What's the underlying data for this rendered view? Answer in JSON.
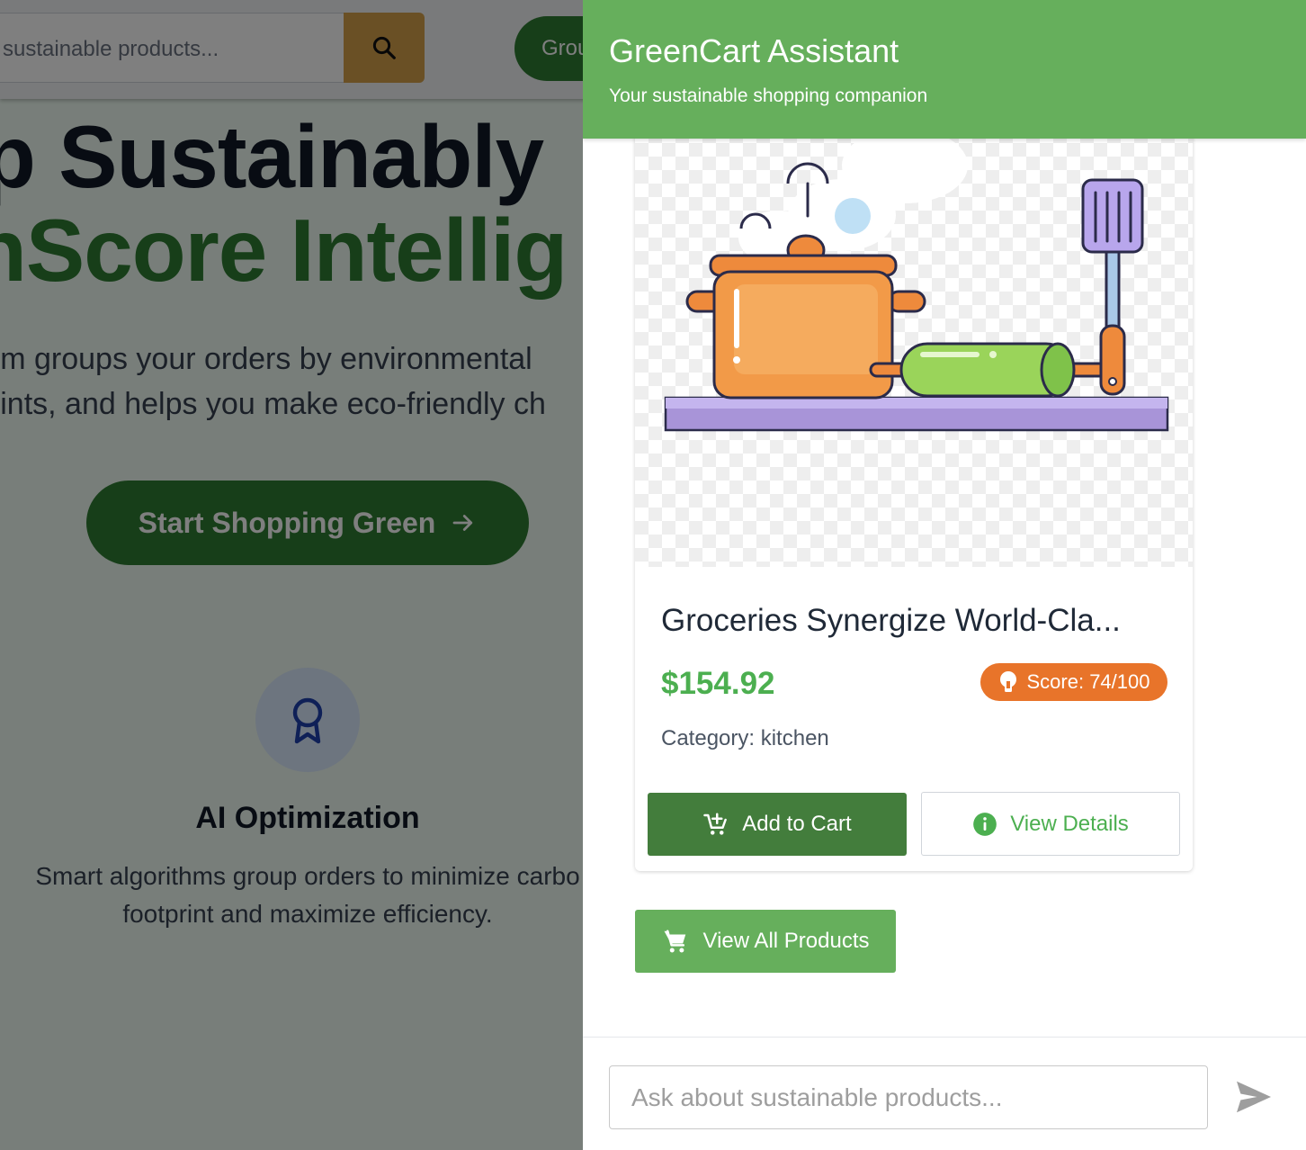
{
  "background": {
    "search_placeholder": "sustainable products...",
    "group_button_label": "Group Orders",
    "hero_line_1": "p Sustainably",
    "hero_line_2": "nScore Intellig",
    "hero_sub_1": "orm groups your orders by environmental",
    "hero_sub_2": "prints, and helps you make eco-friendly ch",
    "cta_label": "Start Shopping Green",
    "feature_title": "AI Optimization",
    "feature_desc_1": "Smart algorithms group orders to minimize carbo",
    "feature_desc_2": "footprint and maximize efficiency."
  },
  "assistant": {
    "title": "GreenCart Assistant",
    "subtitle": "Your sustainable shopping companion",
    "product": {
      "name": "Groceries Synergize World-Cla...",
      "price": "$154.92",
      "score": "Score: 74/100",
      "category": "Category: kitchen",
      "add_to_cart_label": "Add to Cart",
      "view_details_label": "View Details"
    },
    "view_all_label": "View All Products",
    "input_placeholder": "Ask about sustainable products..."
  },
  "colors": {
    "brand_green": "#66af5c",
    "dark_green": "#437d3c",
    "price_green": "#4caf50",
    "score_orange": "#e8742a"
  },
  "icons": [
    "search-icon",
    "arrow-right-icon",
    "award-icon",
    "lightbulb-icon",
    "cart-plus-icon",
    "info-icon",
    "cart-icon",
    "send-icon"
  ]
}
